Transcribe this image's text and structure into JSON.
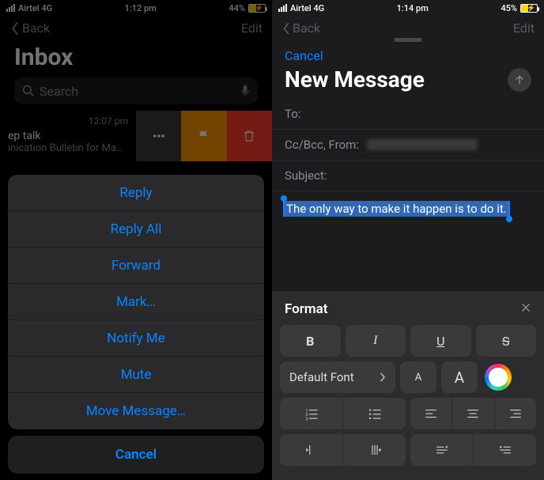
{
  "left": {
    "status": {
      "carrier": "Airtel 4G",
      "time": "1:12 pm",
      "battery_pct": "44%",
      "battery_fill_pct": 44
    },
    "nav": {
      "back": "Back",
      "edit": "Edit"
    },
    "title": "Inbox",
    "search": {
      "placeholder": "Search"
    },
    "message": {
      "time": "12:07 pm",
      "line1": "ep talk",
      "line2": "inication Bulletin for Ma…"
    },
    "swipe_icons": {
      "more": "ellipsis-icon",
      "flag": "flag-icon",
      "trash": "trash-icon"
    },
    "actions": {
      "items": [
        "Reply",
        "Reply All",
        "Forward",
        "Mark…",
        "Notify Me",
        "Mute",
        "Move Message…"
      ],
      "cancel": "Cancel"
    }
  },
  "right": {
    "status": {
      "carrier": "Airtel 4G",
      "time": "1:14 pm",
      "battery_pct": "45%",
      "battery_fill_pct": 45
    },
    "bgnav": {
      "back": "Back",
      "edit": "Edit"
    },
    "sheet": {
      "cancel": "Cancel",
      "title": "New Message",
      "to_label": "To:",
      "ccbcc_label": "Cc/Bcc, From:",
      "subject_label": "Subject:",
      "body_selected": "The only way to make it happen is to do it."
    },
    "format": {
      "title": "Format",
      "bold": "B",
      "italic": "I",
      "underline": "U",
      "strike": "S",
      "font_label": "Default Font",
      "size_dec": "A",
      "size_inc": "A"
    }
  }
}
